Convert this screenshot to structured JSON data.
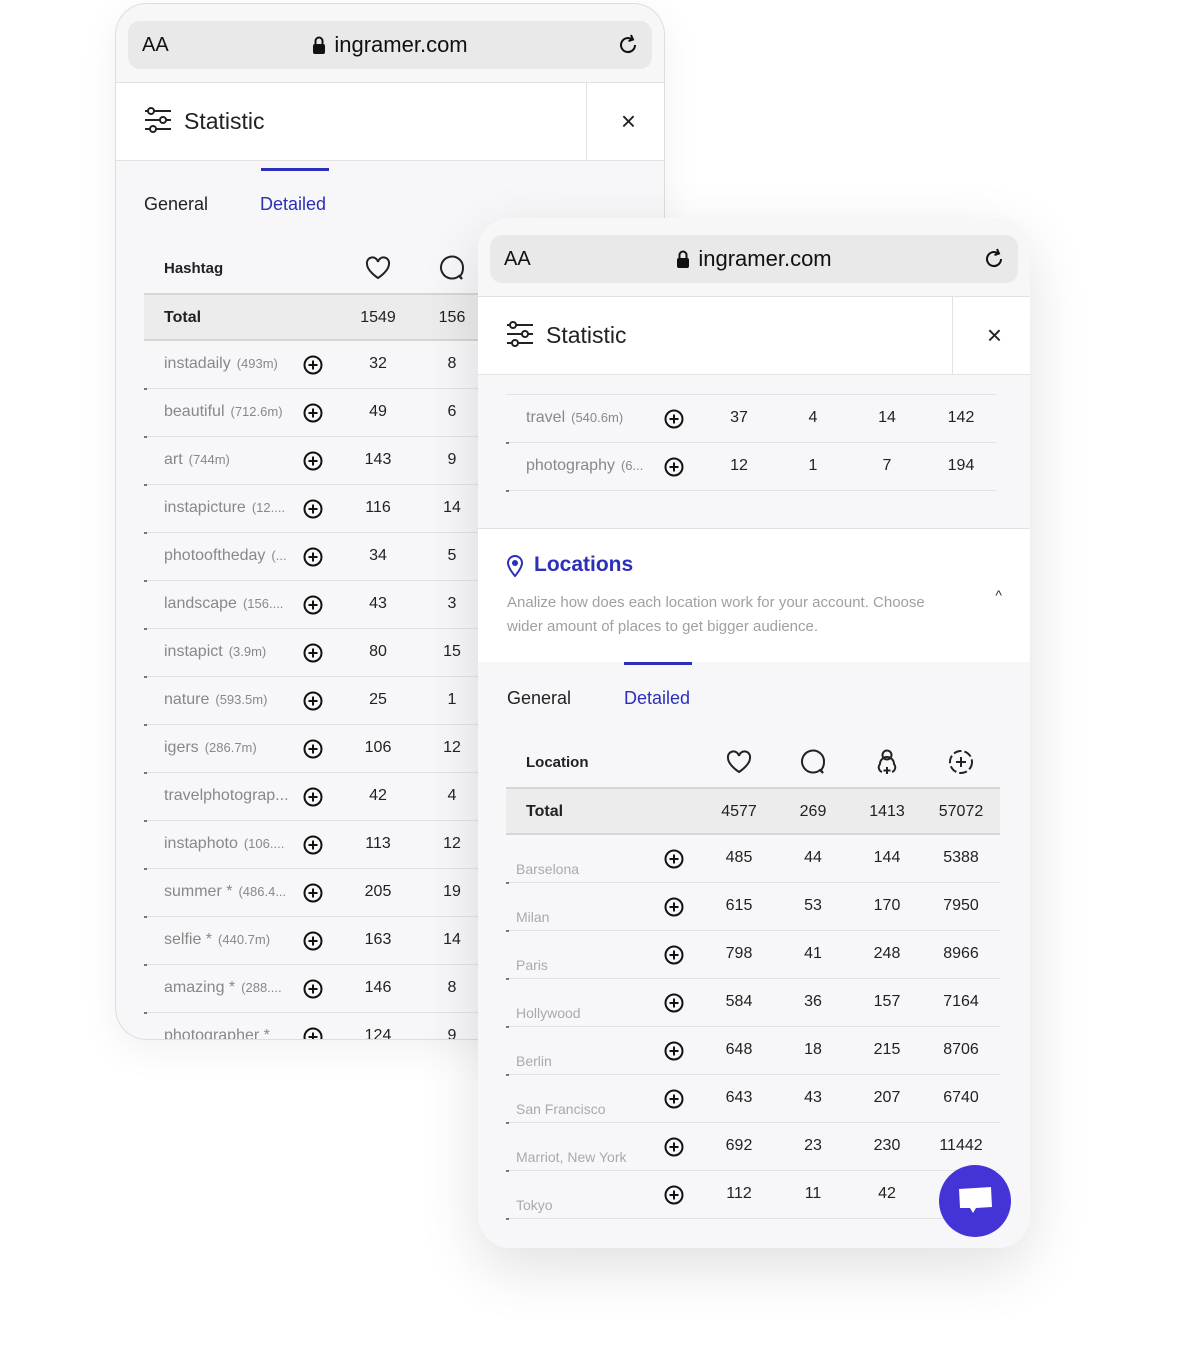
{
  "browser": {
    "aa": "AA",
    "url": "ingramer.com"
  },
  "colors": {
    "accent": "#2b2fb9",
    "fab": "#4434d8"
  },
  "panel1": {
    "title": "Statistic",
    "close": "×",
    "tabs": [
      {
        "label": "General",
        "active": false
      },
      {
        "label": "Detailed",
        "active": true
      }
    ],
    "table": {
      "name_header": "Hashtag",
      "column_icons": [
        "heart-icon",
        "comment-icon"
      ],
      "total": {
        "name": "Total",
        "values": [
          "1549",
          "156"
        ]
      },
      "rows": [
        {
          "name": "instadaily",
          "sub": "(493m)",
          "values": [
            "32",
            "8"
          ]
        },
        {
          "name": "beautiful",
          "sub": "(712.6m)",
          "values": [
            "49",
            "6"
          ]
        },
        {
          "name": "art",
          "sub": "(744m)",
          "values": [
            "143",
            "9"
          ]
        },
        {
          "name": "instapicture",
          "sub": "(12....",
          "values": [
            "116",
            "14"
          ]
        },
        {
          "name": "photooftheday",
          "sub": "(...",
          "values": [
            "34",
            "5"
          ]
        },
        {
          "name": "landscape",
          "sub": "(156....",
          "values": [
            "43",
            "3"
          ]
        },
        {
          "name": "instapict",
          "sub": "(3.9m)",
          "values": [
            "80",
            "15"
          ]
        },
        {
          "name": "nature",
          "sub": "(593.5m)",
          "values": [
            "25",
            "1"
          ]
        },
        {
          "name": "igers",
          "sub": "(286.7m)",
          "values": [
            "106",
            "12"
          ]
        },
        {
          "name": "travelphotograp...",
          "sub": "",
          "values": [
            "42",
            "4"
          ]
        },
        {
          "name": "instaphoto",
          "sub": "(106....",
          "values": [
            "113",
            "12"
          ]
        },
        {
          "name": "summer *",
          "sub": "(486.4...",
          "values": [
            "205",
            "19"
          ]
        },
        {
          "name": "selfie *",
          "sub": "(440.7m)",
          "values": [
            "163",
            "14"
          ]
        },
        {
          "name": "amazing *",
          "sub": "(288....",
          "values": [
            "146",
            "8"
          ]
        },
        {
          "name": "photographer *",
          "sub": "",
          "values": [
            "124",
            "9"
          ]
        }
      ]
    }
  },
  "panel2": {
    "title": "Statistic",
    "close": "×",
    "hashtag_rows": [
      {
        "name": "travel",
        "sub": "(540.6m)",
        "values": [
          "37",
          "4",
          "14",
          "142"
        ]
      },
      {
        "name": "photography",
        "sub": "(6...",
        "values": [
          "12",
          "1",
          "7",
          "194"
        ]
      }
    ],
    "locations": {
      "title": "Locations",
      "description": "Analize how does each location work for your account. Choose wider amount of places to get bigger audience.",
      "chevron": "^"
    },
    "tabs": [
      {
        "label": "General",
        "active": false
      },
      {
        "label": "Detailed",
        "active": true
      }
    ],
    "table": {
      "name_header": "Location",
      "column_icons": [
        "heart-icon",
        "comment-icon",
        "follower-icon",
        "reach-icon"
      ],
      "total": {
        "name": "Total",
        "values": [
          "4577",
          "269",
          "1413",
          "57072"
        ]
      },
      "rows": [
        {
          "name": "Barselona",
          "values": [
            "485",
            "44",
            "144",
            "5388"
          ]
        },
        {
          "name": "Milan",
          "values": [
            "615",
            "53",
            "170",
            "7950"
          ]
        },
        {
          "name": "Paris",
          "values": [
            "798",
            "41",
            "248",
            "8966"
          ]
        },
        {
          "name": "Hollywood",
          "values": [
            "584",
            "36",
            "157",
            "7164"
          ]
        },
        {
          "name": "Berlin",
          "values": [
            "648",
            "18",
            "215",
            "8706"
          ]
        },
        {
          "name": "San Francisco",
          "values": [
            "643",
            "43",
            "207",
            "6740"
          ]
        },
        {
          "name": "Marriot, New York",
          "values": [
            "692",
            "23",
            "230",
            "11442"
          ]
        },
        {
          "name": "Tokyo",
          "values": [
            "112",
            "11",
            "42",
            ""
          ]
        }
      ]
    }
  }
}
